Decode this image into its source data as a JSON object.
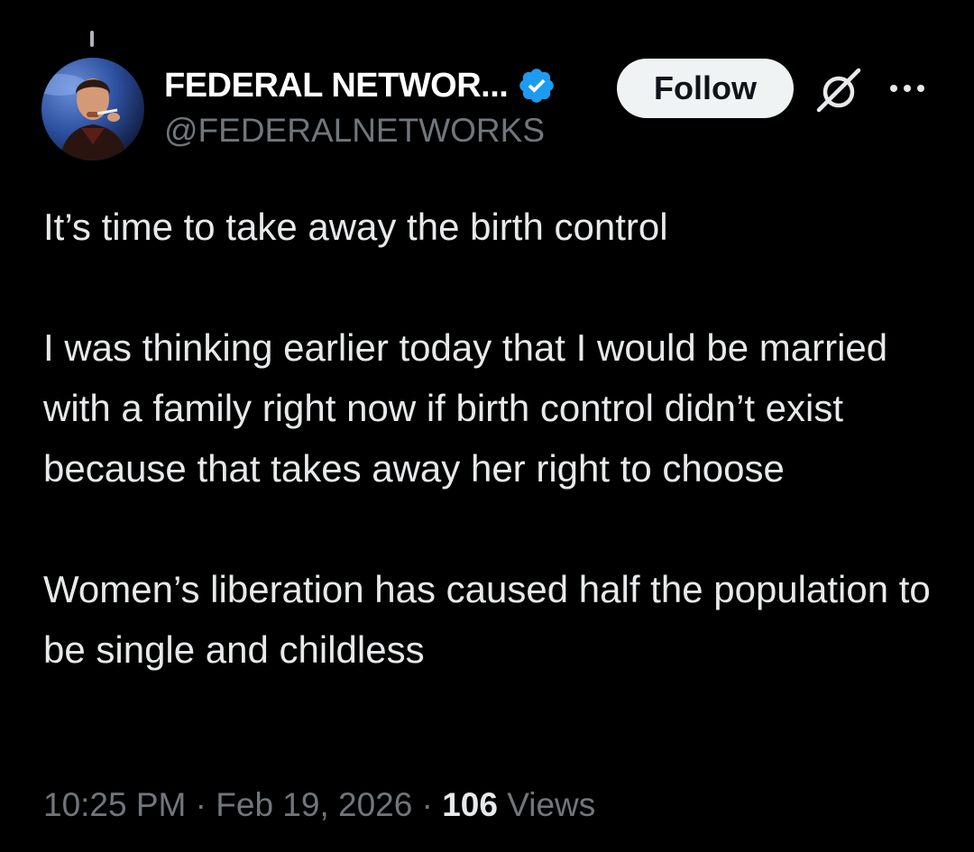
{
  "author": {
    "display_name": "FEDERAL NETWOR...",
    "handle": "@FEDERALNETWORKS",
    "verified": true
  },
  "actions": {
    "follow_label": "Follow",
    "grok_icon": "grok-icon",
    "more_icon": "more-icon"
  },
  "tweet": {
    "paragraphs": [
      "It’s time to take away the birth control",
      "I was thinking earlier today that I would be married with a family right now if birth control didn’t exist because that takes away her right to choose",
      "Women’s liberation has caused half the population to be single and childless"
    ]
  },
  "meta": {
    "time": "10:25 PM",
    "separator": "·",
    "date": "Feb 19, 2026",
    "views_count": "106",
    "views_label": "Views"
  },
  "colors": {
    "background": "#000000",
    "text": "#e7e9ea",
    "muted": "#71767b",
    "verified_blue": "#1d9bf0",
    "follow_bg": "#eff3f4"
  }
}
